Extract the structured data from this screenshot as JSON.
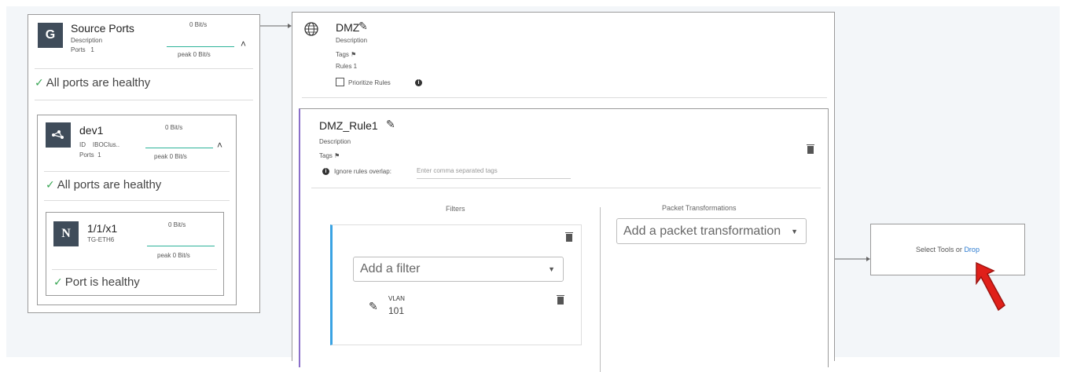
{
  "source": {
    "title": "Source Ports",
    "description_label": "Description",
    "ports_label": "Ports",
    "ports_value": "1",
    "rate": "0 Bit/s",
    "peak": "peak 0 Bit/s",
    "health": "All ports are healthy",
    "icon_glyph": "G"
  },
  "device": {
    "title": "dev1",
    "id_label": "ID",
    "id_value": "IBOClus..",
    "ports_label": "Ports",
    "ports_value": "1",
    "rate": "0 Bit/s",
    "peak": "peak 0 Bit/s",
    "health": "All ports are healthy"
  },
  "port": {
    "title": "1/1/x1",
    "subtitle": "TG-ETH6",
    "rate": "0 Bit/s",
    "peak": "peak 0 Bit/s",
    "health": "Port is healthy",
    "icon_glyph": "N"
  },
  "dmz": {
    "title": "DMZ",
    "description_label": "Description",
    "tags_label": "Tags",
    "rules_label": "Rules 1",
    "prioritize_label": "Prioritize Rules"
  },
  "rule": {
    "title": "DMZ_Rule1",
    "description_label": "Description",
    "tags_label": "Tags",
    "ignore_label": "Ignore rules overlap:",
    "ignore_placeholder": "Enter comma separated tags",
    "filters_heading": "Filters",
    "transform_heading": "Packet Transformations",
    "add_filter": "Add a filter",
    "add_transformation": "Add a packet transformation",
    "filter_item_label": "VLAN",
    "filter_item_value": "101"
  },
  "tools": {
    "prefix": "Select Tools or ",
    "drop_link": "Drop"
  },
  "colors": {
    "rule_accent": "#8a6fc9",
    "filter_accent": "#3aa3e3",
    "healthy_check": "#3aa655",
    "link": "#2c7bd0",
    "arrow_annotation": "#e0201a"
  }
}
